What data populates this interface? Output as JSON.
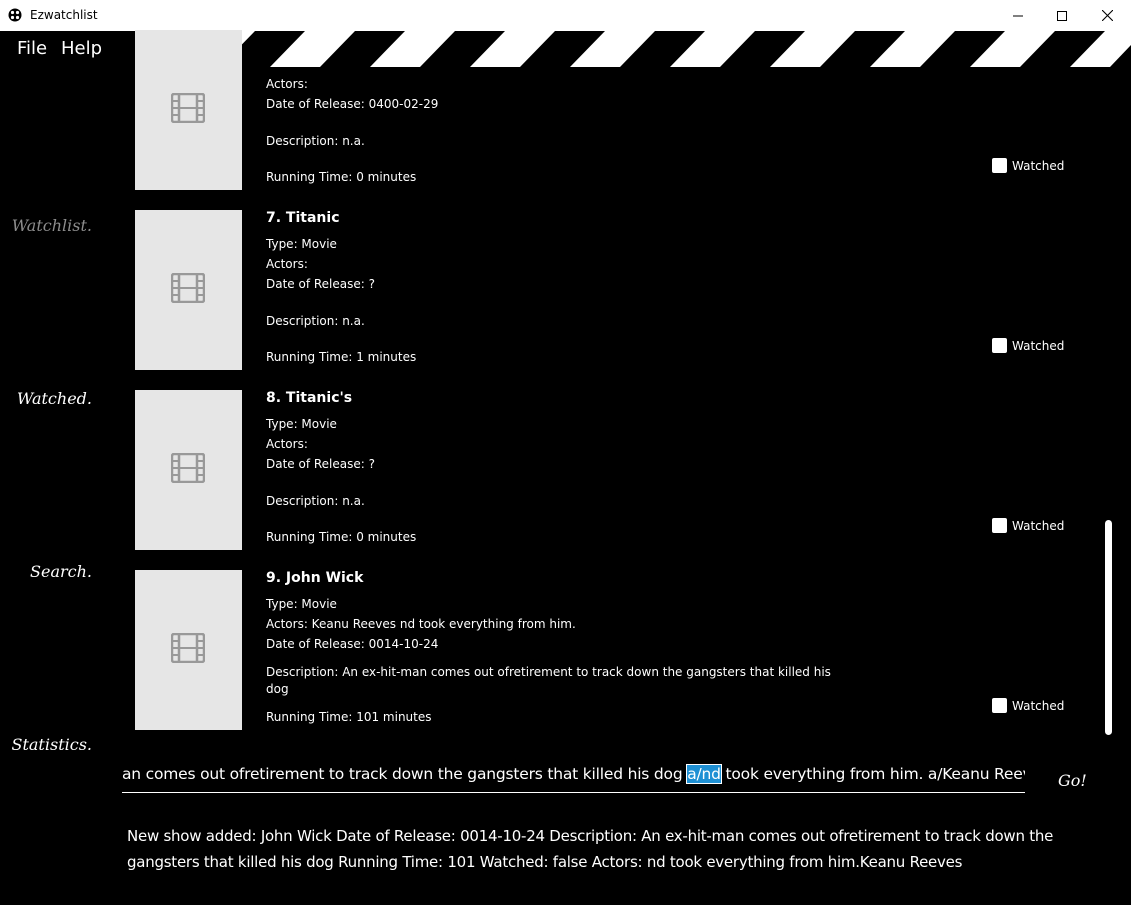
{
  "window": {
    "title": "Ezwatchlist"
  },
  "menu": {
    "file": "File",
    "help": "Help"
  },
  "sidebar": {
    "watchlist": "Watchlist.",
    "watched": "Watched.",
    "search": "Search.",
    "statistics": "Statistics."
  },
  "cards": [
    {
      "heading": "",
      "type": "",
      "actors": "Actors:",
      "release": "Date of Release: 0400-02-29",
      "description": "Description: n.a.",
      "description2": "",
      "running": "Running Time: 0 minutes",
      "watched_label": "Watched"
    },
    {
      "heading": "7.  Titanic",
      "type": "Type: Movie",
      "actors": "Actors:",
      "release": "Date of Release: ?",
      "description": "Description: n.a.",
      "description2": "",
      "running": "Running Time: 1 minutes",
      "watched_label": "Watched"
    },
    {
      "heading": "8.  Titanic's",
      "type": "Type: Movie",
      "actors": "Actors:",
      "release": "Date of Release: ?",
      "description": "Description: n.a.",
      "description2": "",
      "running": "Running Time: 0 minutes",
      "watched_label": "Watched"
    },
    {
      "heading": "9.  John Wick",
      "type": "Type: Movie",
      "actors": "Actors:   Keanu Reeves  nd took everything from him.",
      "release": "Date of Release: 0014-10-24",
      "description": "Description: An ex-hit-man comes out ofretirement to track down the gangsters that killed his",
      "description2": "dog",
      "running": "Running Time: 101 minutes",
      "watched_label": "Watched"
    }
  ],
  "command": {
    "before": "an comes out ofretirement to track down the gangsters that killed his dog ",
    "selected": "a/nd",
    "after": " took everything from him. a/Keanu Reeves",
    "go": "Go!"
  },
  "result": {
    "text": "New show added: John Wick Date of Release: 0014-10-24 Description: An ex-hit-man comes out ofretirement to track down the gangsters that killed his dog Running Time: 101 Watched: false Actors: nd took everything from him.Keanu Reeves"
  }
}
